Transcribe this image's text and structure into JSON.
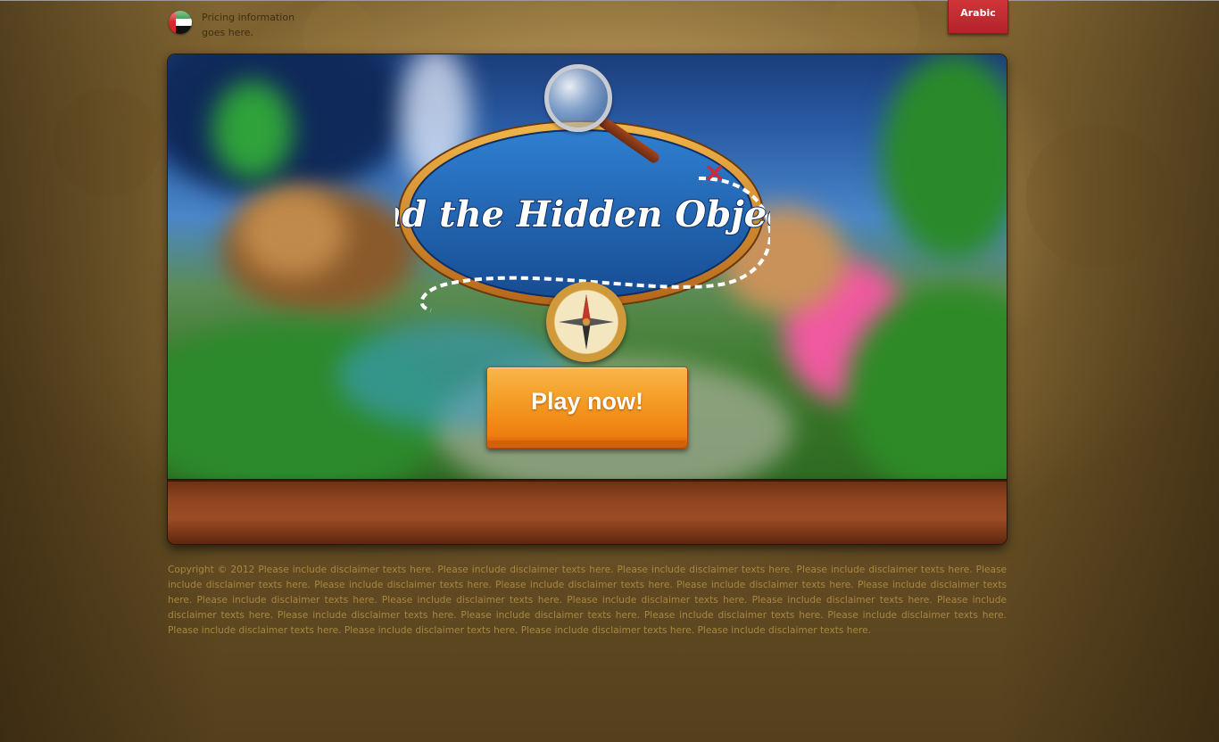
{
  "header": {
    "pricing_text": "Pricing information goes here.",
    "language_button": "Arabic",
    "flag_icon": "uae-flag-icon"
  },
  "hero": {
    "logo_text": "Find the Hidden Objects",
    "play_button": "Play now!"
  },
  "footer": {
    "disclaimer": "Copyright © 2012 Please include disclaimer texts here. Please include disclaimer texts here. Please include disclaimer texts here. Please include disclaimer texts here. Please include disclaimer texts here. Please include disclaimer texts here. Please include disclaimer texts here. Please include disclaimer texts here. Please include disclaimer texts here. Please include disclaimer texts here. Please include disclaimer texts here. Please include disclaimer texts here. Please include disclaimer texts here. Please include disclaimer texts here. Please include disclaimer texts here. Please include disclaimer texts here. Please include disclaimer texts here. Please include disclaimer texts here. Please include disclaimer texts here. Please include disclaimer texts here. Please include disclaimer texts here. Please include disclaimer texts here."
  },
  "colors": {
    "language_button": "#c02a30",
    "play_button": "#f49a22",
    "wood_panel": "#8e4420",
    "disclaimer_text": "#a8873f"
  }
}
